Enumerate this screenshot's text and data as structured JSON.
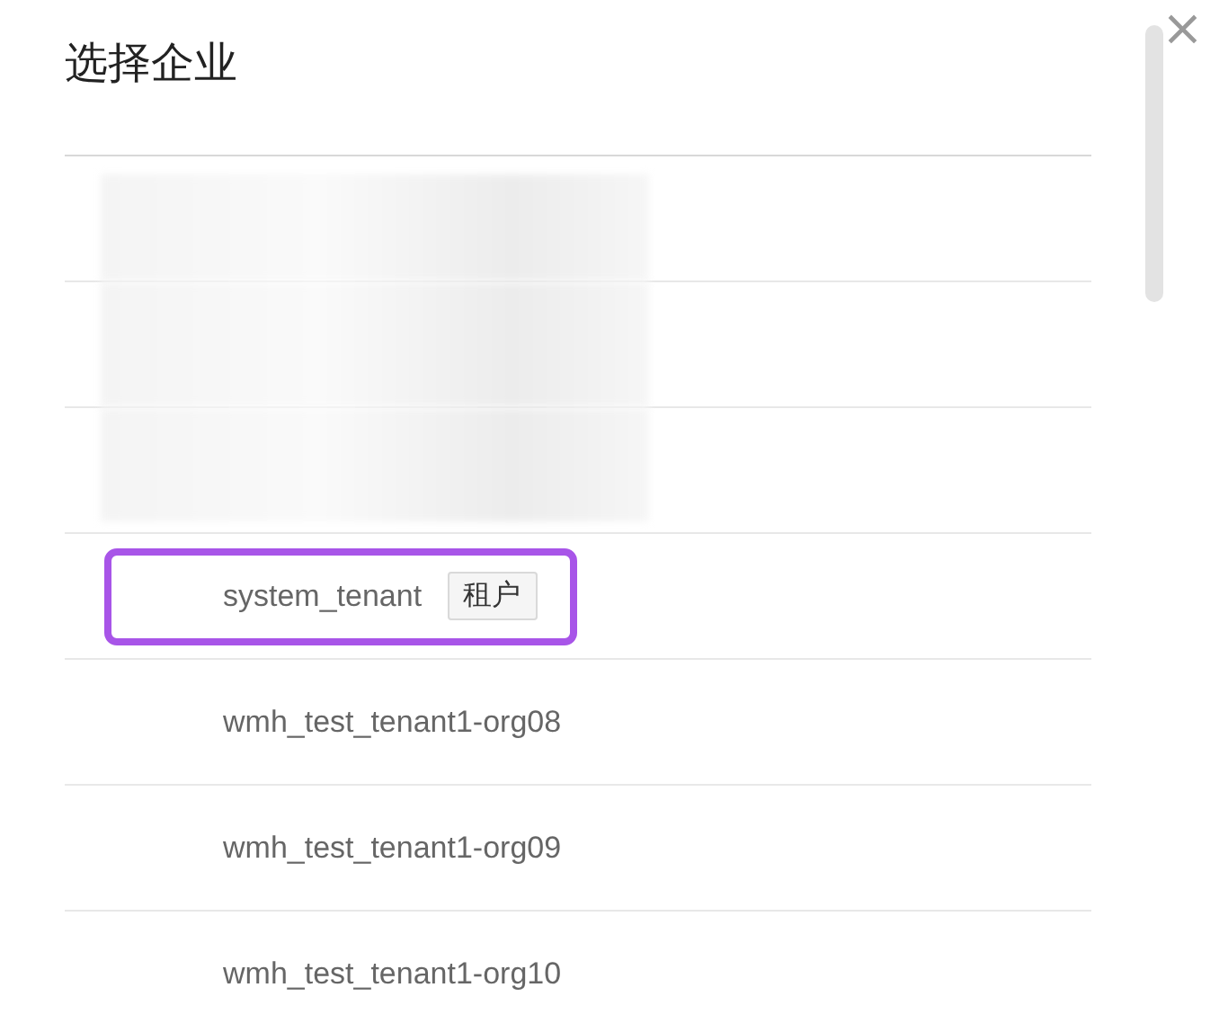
{
  "dialog": {
    "title": "选择企业",
    "close": "×"
  },
  "rows": [
    {
      "kind": "redacted",
      "highlighted": false
    },
    {
      "kind": "redacted",
      "highlighted": false
    },
    {
      "kind": "redacted",
      "highlighted": false
    },
    {
      "kind": "tenant",
      "name": "system_tenant",
      "tag": "租户",
      "highlighted": true
    },
    {
      "kind": "tenant",
      "name": "wmh_test_tenant1-org08",
      "highlighted": false
    },
    {
      "kind": "tenant",
      "name": "wmh_test_tenant1-org09",
      "highlighted": false
    },
    {
      "kind": "tenant",
      "name": "wmh_test_tenant1-org10",
      "highlighted": false
    }
  ]
}
